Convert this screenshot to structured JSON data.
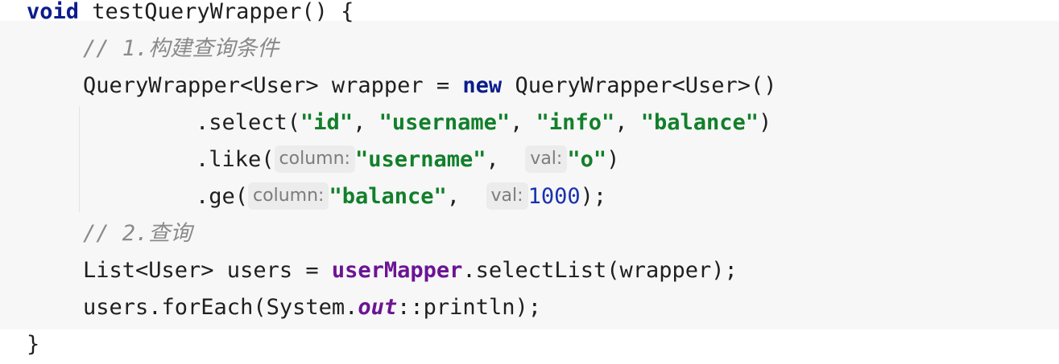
{
  "code": {
    "line1": {
      "keyword": "void",
      "signature": " testQueryWrapper() {"
    },
    "comment1": "// 1.构建查询条件",
    "line3": {
      "a": "QueryWrapper<User> wrapper = ",
      "keyword": "new",
      "b": " QueryWrapper<User>()"
    },
    "line4": {
      "method": ".select(",
      "s1": "\"id\"",
      "sep1": ", ",
      "s2": "\"username\"",
      "sep2": ", ",
      "s3": "\"info\"",
      "sep3": ", ",
      "s4": "\"balance\"",
      "end": ")"
    },
    "line5": {
      "method": ".like(",
      "hint1": "column:",
      "s1": "\"username\"",
      "sep": ", ",
      "hint2": "val:",
      "s2": "\"o\"",
      "end": ")"
    },
    "line6": {
      "method": ".ge(",
      "hint1": "column:",
      "s1": "\"balance\"",
      "sep": ", ",
      "hint2": "val:",
      "num": "1000",
      "end": ");"
    },
    "comment2": "// 2.查询",
    "line8": {
      "a": "List<User> users = ",
      "field": "userMapper",
      "b": ".selectList(wrapper);"
    },
    "line9": {
      "a": "users.forEach(System.",
      "static": "out",
      "b": "::println);"
    },
    "line10": "}"
  },
  "colors": {
    "keyword": "#0b1d8c",
    "string": "#127f2b",
    "number": "#1a32b0",
    "comment": "#8a8a8a",
    "field": "#6b1494",
    "hint_bg": "#ececec"
  }
}
